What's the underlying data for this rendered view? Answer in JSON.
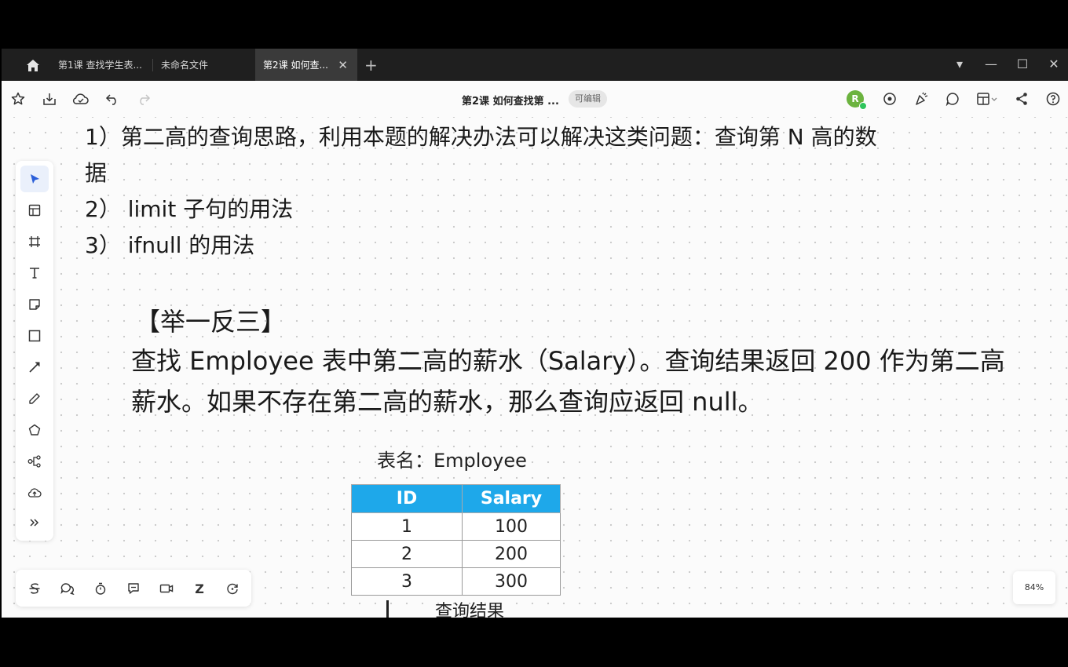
{
  "tabs": [
    {
      "label": "第1课 查找学生表..."
    },
    {
      "label": "未命名文件"
    },
    {
      "label": "第2课 如何查...",
      "close": "✕"
    }
  ],
  "newtab": "+",
  "window_controls": {
    "dropdown": "▾",
    "minimize": "—",
    "maximize": "☐",
    "close": "✕"
  },
  "toolbar": {
    "doc_title": "第2课 如何查找第 ...",
    "status_badge": "可编辑",
    "avatar_initial": "R"
  },
  "content": {
    "point1": "1）第二高的查询思路，利用本题的解决办法可以解决这类问题：查询第 N 高的数",
    "point1_cont": "据",
    "point2": "2） limit 子句的用法",
    "point3": "3） ifnull 的用法",
    "example_heading": "【举一反三】",
    "example_line1": "查找 Employee 表中第二高的薪水（Salary）。查询结果返回 200 作为第二高",
    "example_line2": "薪水。如果不存在第二高的薪水，那么查询应返回 null。",
    "table_caption": "表名：Employee",
    "result_caption": "查询结果"
  },
  "employee_table": {
    "headers": [
      "ID",
      "Salary"
    ],
    "rows": [
      [
        "1",
        "100"
      ],
      [
        "2",
        "200"
      ],
      [
        "3",
        "300"
      ]
    ]
  },
  "zoom_level": "84%",
  "bottom_tools": {
    "text_z": "Z"
  },
  "colors": {
    "table_header": "#1ea8ea",
    "avatar": "#6cb33f",
    "active_tool": "#2b5fd9"
  }
}
